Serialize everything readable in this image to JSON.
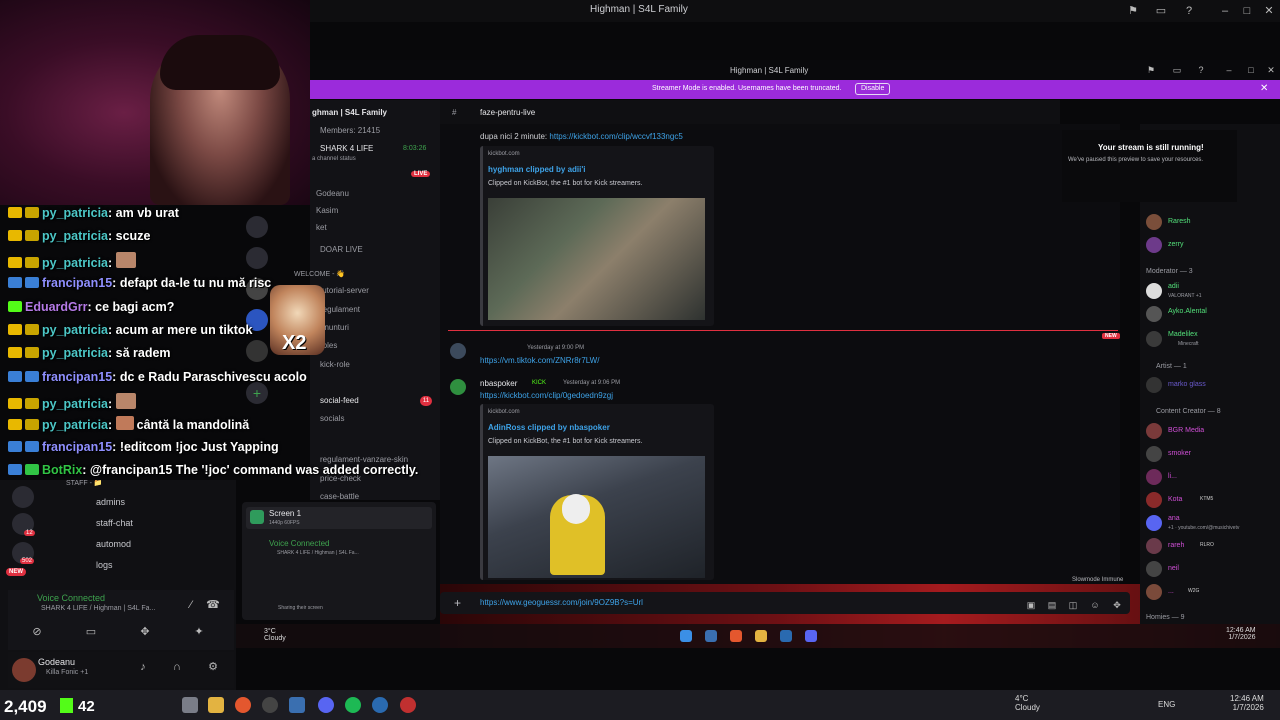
{
  "outer_window": {
    "title": "Highman | S4L Family"
  },
  "inner_window": {
    "title": "Highman | S4L Family"
  },
  "streamer_banner": {
    "text": "Streamer Mode is enabled. Usernames have been truncated.",
    "button": "Disable"
  },
  "server": {
    "name": "ghman | S4L Family",
    "members": "Members: 21415",
    "live_channel": "SHARK 4 LIFE",
    "live_timer": "8:03:26",
    "live_badge": "LIVE",
    "channel_status": "a channel status",
    "voice_users": [
      "Godeanu",
      "Kasim",
      "ket"
    ],
    "channels": [
      "DOAR LIVE",
      "WELCOME - 👋",
      "tutorial-server",
      "regulament",
      "anunturi",
      "roles",
      "kick-role",
      "social-feed",
      "socials",
      "regulament-vanzare-skin",
      "price-check",
      "case-battle"
    ],
    "social_feed_badge": "11"
  },
  "channel": {
    "name": "faze-pentru-live"
  },
  "messages": [
    {
      "text": "dupa nici 2 minute:",
      "link": "https://kickbot.com/clip/wccvf133ngc5"
    },
    {
      "embed_site": "kickbot.com",
      "embed_title": "hyghman clipped by adii'i",
      "embed_desc": "Clipped on KickBot, the #1 bot for Kick streamers."
    },
    {
      "meta": "Yesterday at 9:00 PM",
      "link": "https://vm.tiktok.com/ZNRr8r7LW/"
    },
    {
      "author": "nbaspoker",
      "tag": "KICK",
      "meta": "Yesterday at 9:06 PM",
      "link": "https://kickbot.com/clip/0gedoedn9zgj"
    },
    {
      "embed_site": "kickbot.com",
      "embed_title": "AdinRoss clipped by nbaspoker",
      "embed_desc": "Clipped on KickBot, the #1 bot for Kick streamers."
    }
  ],
  "new_badge": "NEW",
  "slowmode": "Slowmode Immune",
  "message_input": "https://www.geoguessr.com/join/9OZ9B?s=Url",
  "stream_notice": {
    "title": "Your stream is still running!",
    "subtitle": "We've paused this preview to save your resources."
  },
  "member_list": {
    "top": [
      "Raresh",
      "zerry"
    ],
    "moderator_header": "Moderator — 3",
    "moderators": [
      {
        "name": "adii",
        "sub": "VALORANT +1"
      },
      {
        "name": "Ayko.Alental",
        "sub": "S4L"
      },
      {
        "name": "Madelilex",
        "sub": "Minecraft"
      }
    ],
    "artist_header": "Artist — 1",
    "artists": [
      "marko glass"
    ],
    "creator_header": "Content Creator — 8",
    "creators": [
      "BGR Media",
      "smoker",
      "li...",
      "Kota",
      "ana",
      "rareh",
      "neil",
      "..."
    ],
    "creator_subs": [
      "KTM5",
      "+1 · youtube.com/@musichivetv",
      "RLRO",
      "W2G"
    ],
    "homies_header": "Homies — 9"
  },
  "inner_voice": {
    "screen_label": "Screen 1",
    "screen_sub": "1440p 60FPS",
    "voice_connected": "Voice Connected",
    "voice_path": "SHARK 4 LIFE / Highman | S4L Fa...",
    "sharing": "Sharing their screen"
  },
  "inner_taskbar": {
    "temp": "3°C",
    "weather": "Cloudy",
    "time": "12:46 AM",
    "date": "1/7/2026"
  },
  "outer_panel": {
    "channels": [
      "admins",
      "staff-chat",
      "automod",
      "logs"
    ],
    "staff_header": "STAFF - 📁",
    "voice_connected": "Voice Connected",
    "voice_path": "SHARK 4 LIFE / Highman | S4L Fa...",
    "username": "Godeanu",
    "user_sub": "Killa Fonic +1",
    "server_badges": [
      "13",
      "12",
      "502"
    ],
    "new_badge": "NEW"
  },
  "chat_overlay": [
    {
      "nick": "py_patricia",
      "text": "am vb urat",
      "color": "p"
    },
    {
      "nick": "py_patricia",
      "text": "scuze",
      "color": "p"
    },
    {
      "nick": "py_patricia",
      "text": "",
      "color": "p"
    },
    {
      "nick": "francipan15",
      "text": "defapt da-le tu nu mă risc",
      "color": "f"
    },
    {
      "nick": "EduardGrr",
      "text": "ce bagi acm?",
      "color": "e"
    },
    {
      "nick": "py_patricia",
      "text": "acum ar mere un tiktok",
      "color": "p"
    },
    {
      "nick": "py_patricia",
      "text": "să radem",
      "color": "p"
    },
    {
      "nick": "francipan15",
      "text": "dc e Radu Paraschivescu acolo",
      "color": "f"
    },
    {
      "nick": "py_patricia",
      "text": "",
      "color": "p"
    },
    {
      "nick": "py_patricia",
      "text": "cântă la mandolină",
      "color": "p"
    },
    {
      "nick": "francipan15",
      "text": "!editcom !joc Just Yapping",
      "color": "f"
    },
    {
      "nick": "BotRix",
      "text": "@francipan15 The '!joc' command was added correctly.",
      "color": "b"
    }
  ],
  "overlay_sticker": "X2",
  "stream_stats": {
    "viewers": "2,409",
    "kick": "42"
  },
  "outer_taskbar": {
    "temp": "4°C",
    "weather": "Cloudy",
    "lang": "ENG",
    "time": "12:46 AM",
    "date": "1/7/2026"
  },
  "colors": {
    "accent": "#9b2bdb",
    "link": "#3ea3e8",
    "kick_green": "#53fc18",
    "live_red": "#e03040"
  }
}
